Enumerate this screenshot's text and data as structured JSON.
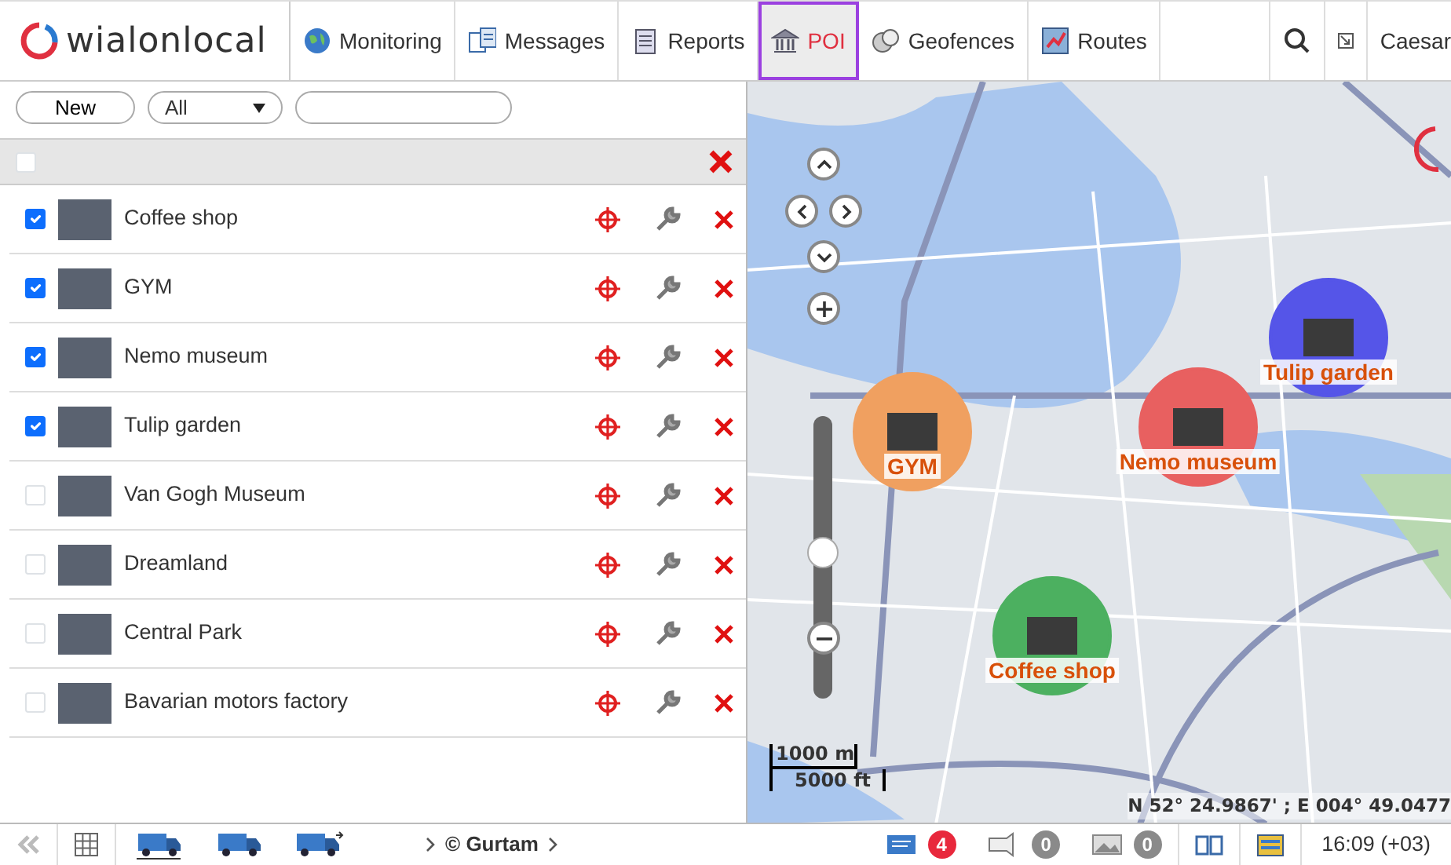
{
  "logo": {
    "text": "wialonlocal"
  },
  "tabs": [
    {
      "label": "Monitoring",
      "kind": "globe",
      "selected": false
    },
    {
      "label": "Messages",
      "kind": "messages",
      "selected": false
    },
    {
      "label": "Reports",
      "kind": "reports",
      "selected": false
    },
    {
      "label": "POI",
      "kind": "poi",
      "selected": true
    },
    {
      "label": "Geofences",
      "kind": "geofences",
      "selected": false
    },
    {
      "label": "Routes",
      "kind": "routes",
      "selected": false
    }
  ],
  "user": {
    "name": "Caesar"
  },
  "toolbar": {
    "new_button": "New",
    "filter": "All"
  },
  "header_row": {
    "checked": false
  },
  "items": [
    {
      "name": "Coffee shop",
      "checked": true
    },
    {
      "name": "GYM",
      "checked": true
    },
    {
      "name": "Nemo museum",
      "checked": true
    },
    {
      "name": "Tulip garden",
      "checked": true
    },
    {
      "name": "Van Gogh Museum",
      "checked": false
    },
    {
      "name": "Dreamland",
      "checked": false
    },
    {
      "name": "Central Park",
      "checked": false
    },
    {
      "name": "Bavarian motors factory",
      "checked": false
    }
  ],
  "map": {
    "markers": [
      {
        "label": "GYM",
        "color": "#f0a060"
      },
      {
        "label": "Nemo museum",
        "color": "#e86060"
      },
      {
        "label": "Tulip garden",
        "color": "#5555e8"
      },
      {
        "label": "Coffee shop",
        "color": "#4cb060"
      }
    ],
    "zoom": {
      "level": 0.52
    },
    "scale": [
      "1000 m",
      "5000 ft"
    ],
    "coordinates": "N 52° 24.9867' ; E 004° 49.0477"
  },
  "status_bar": {
    "copyright": "© Gurtam",
    "counters": [
      {
        "kind": "messages",
        "value": "4",
        "color": "#e8283c"
      },
      {
        "kind": "notifications",
        "value": "0",
        "color": "#8a8a8a"
      },
      {
        "kind": "images",
        "value": "0",
        "color": "#8a8a8a"
      }
    ],
    "time": "16:09 (+03)"
  }
}
